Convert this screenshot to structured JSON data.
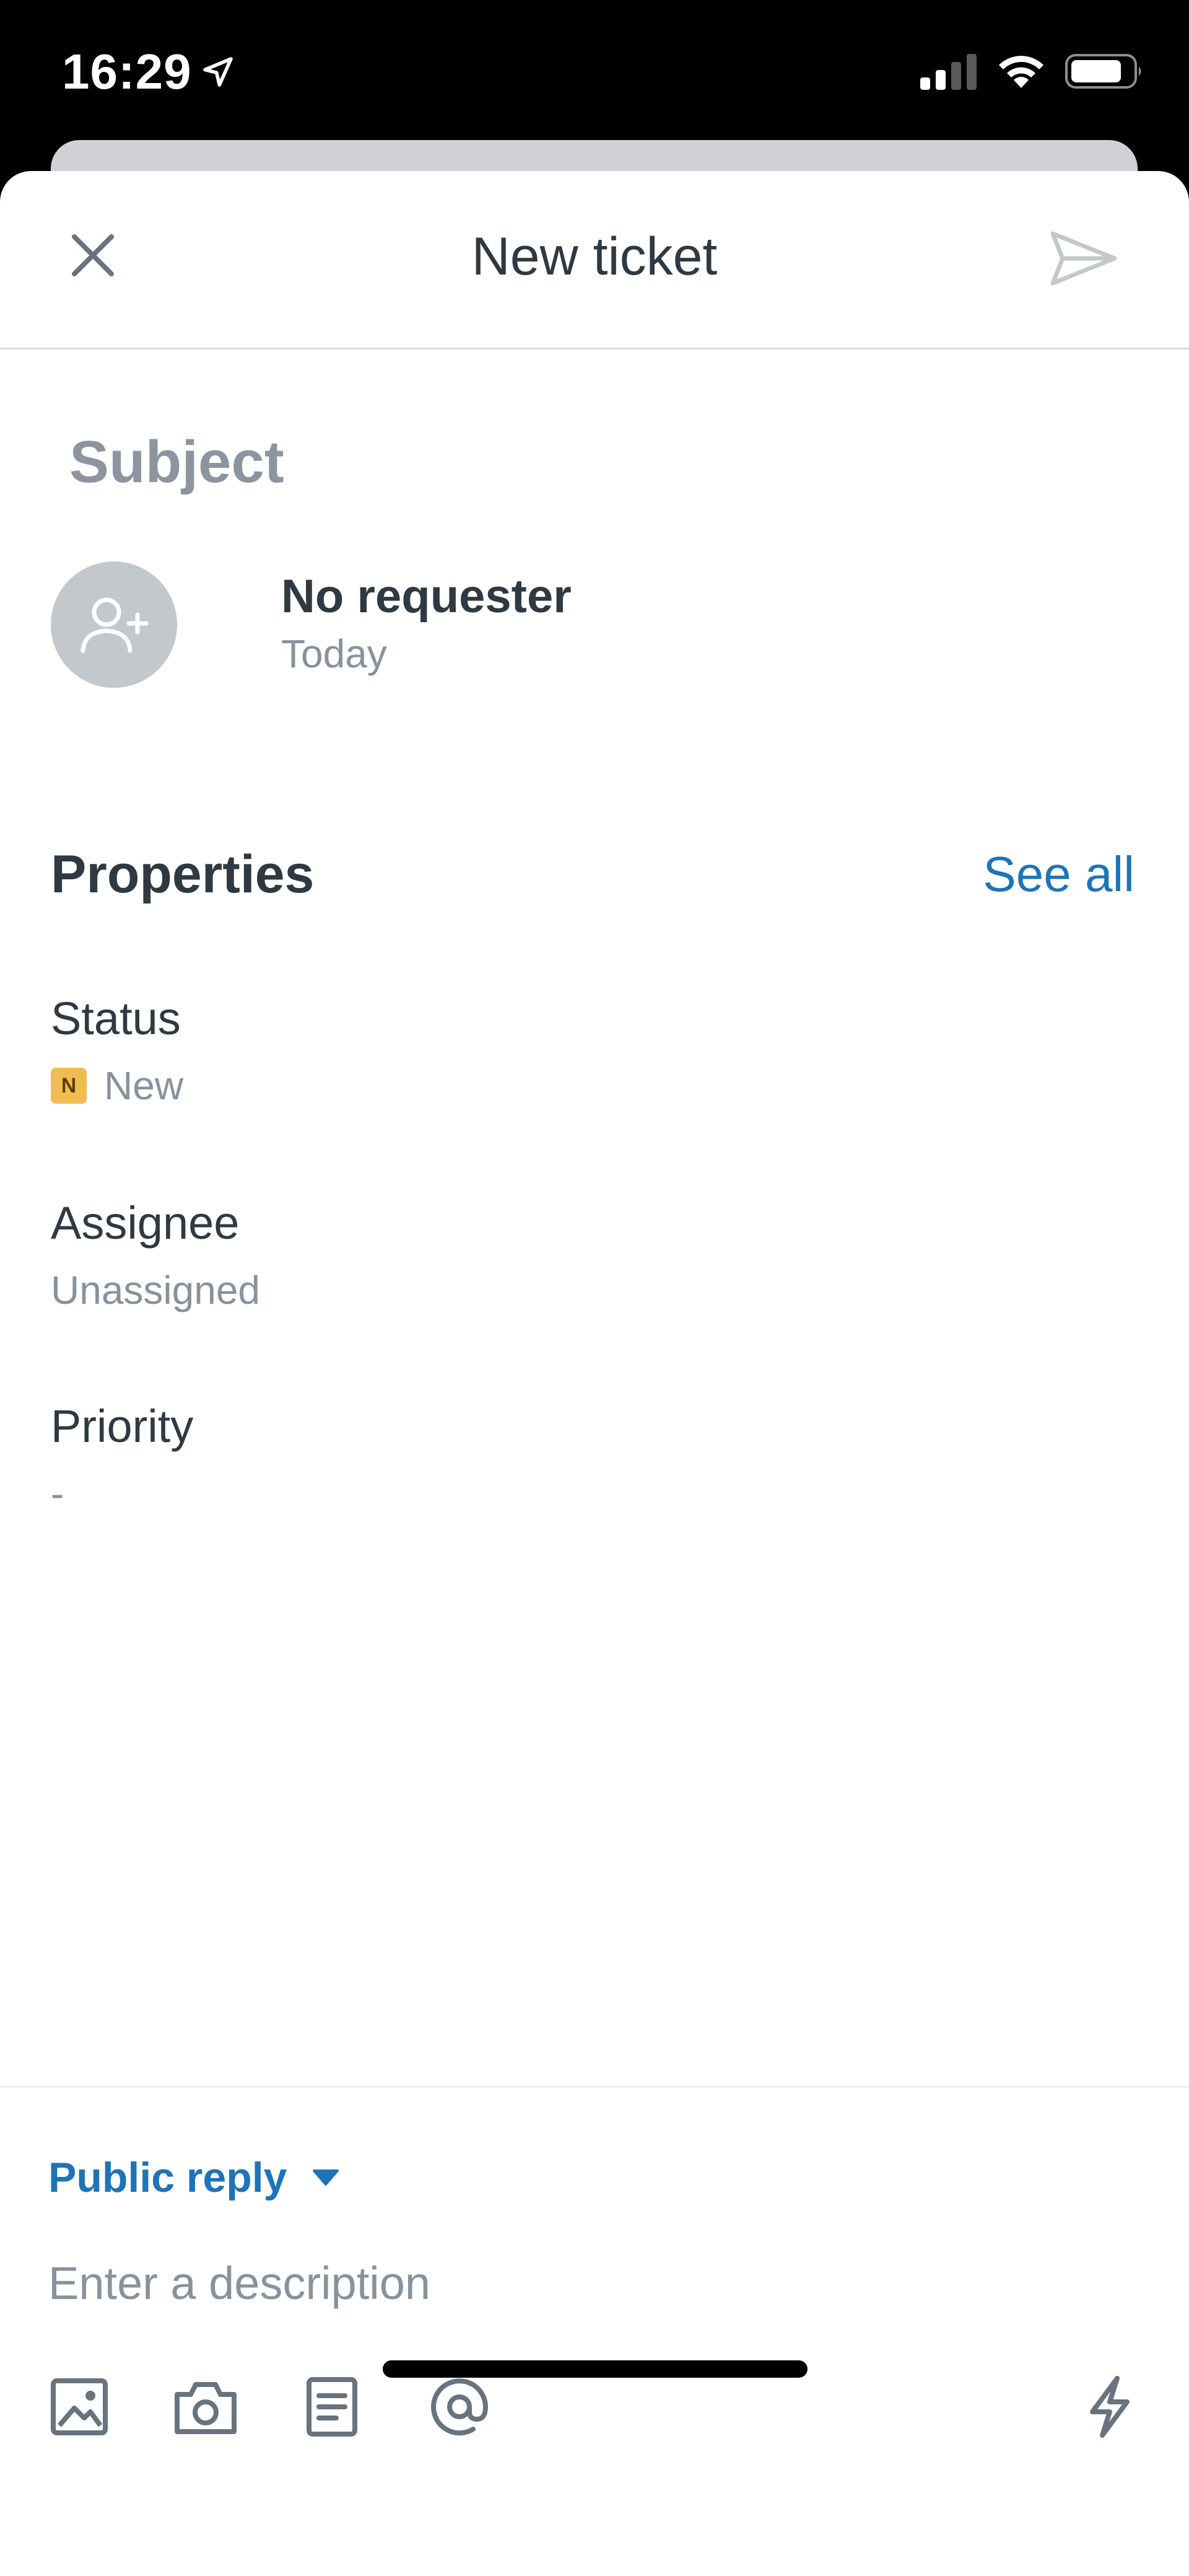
{
  "status_bar": {
    "time": "16:29"
  },
  "header": {
    "title": "New ticket"
  },
  "ticket": {
    "subject_placeholder": "Subject",
    "requester_name": "No requester",
    "requester_date": "Today"
  },
  "properties": {
    "title": "Properties",
    "see_all_label": "See all",
    "status": {
      "label": "Status",
      "badge": "N",
      "value": "New",
      "badge_color": "#f1bc51"
    },
    "assignee": {
      "label": "Assignee",
      "value": "Unassigned"
    },
    "priority": {
      "label": "Priority",
      "value": "-"
    }
  },
  "composer": {
    "reply_type": "Public reply",
    "description_placeholder": "Enter a description"
  },
  "colors": {
    "accent": "#1f73b7",
    "text": "#2f3941",
    "muted": "#87929d",
    "icon": "#68737d"
  },
  "icons": {
    "close": "close-icon",
    "send": "send-icon",
    "avatar": "add-person-icon",
    "image": "image-icon",
    "camera": "camera-icon",
    "macro": "document-icon",
    "mention": "at-icon",
    "shortcut": "lightning-icon"
  }
}
